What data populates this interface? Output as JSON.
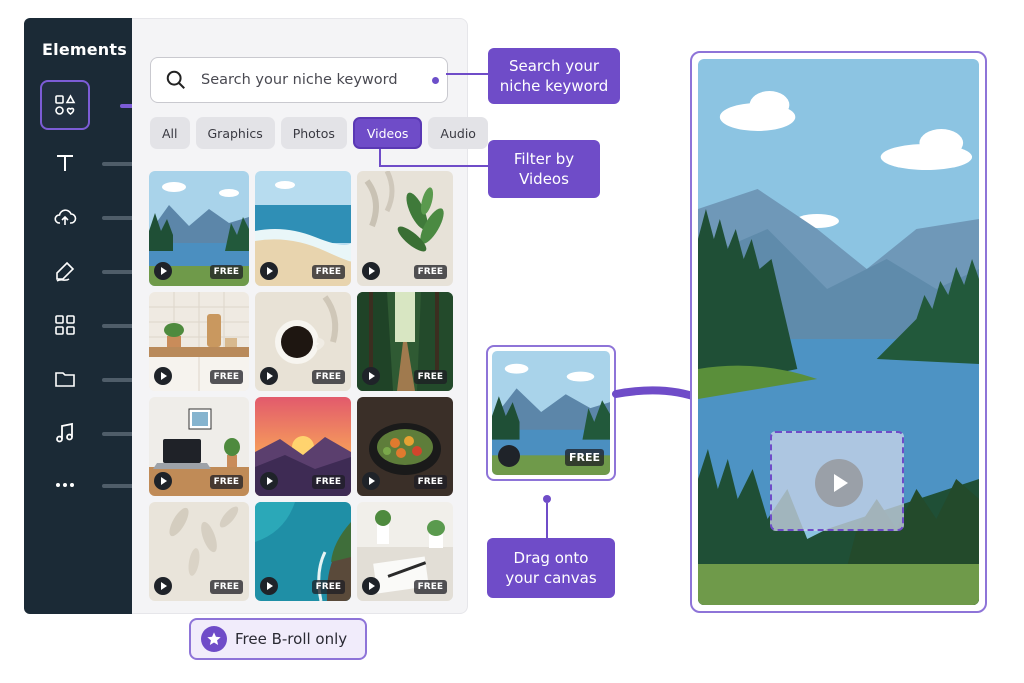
{
  "sidebar": {
    "title": "Elements",
    "items": [
      {
        "name": "elements-icon"
      },
      {
        "name": "text-icon"
      },
      {
        "name": "upload-icon"
      },
      {
        "name": "draw-icon"
      },
      {
        "name": "apps-icon"
      },
      {
        "name": "folder-icon"
      },
      {
        "name": "music-icon"
      },
      {
        "name": "more-icon"
      }
    ]
  },
  "search": {
    "placeholder": "Search your niche keyword"
  },
  "filters": [
    "All",
    "Graphics",
    "Photos",
    "Videos",
    "Audio"
  ],
  "active_filter": "Videos",
  "tiles": [
    {
      "scene": "mountain-lake",
      "badge": "FREE"
    },
    {
      "scene": "beach",
      "badge": "FREE"
    },
    {
      "scene": "plant-shadow",
      "badge": "FREE"
    },
    {
      "scene": "kitchen",
      "badge": "FREE"
    },
    {
      "scene": "coffee",
      "badge": "FREE"
    },
    {
      "scene": "forest-path",
      "badge": "FREE"
    },
    {
      "scene": "laptop-desk",
      "badge": "FREE"
    },
    {
      "scene": "sunset",
      "badge": "FREE"
    },
    {
      "scene": "food-bowl",
      "badge": "FREE"
    },
    {
      "scene": "leaf-shadow",
      "badge": "FREE"
    },
    {
      "scene": "coast",
      "badge": "FREE"
    },
    {
      "scene": "notebook",
      "badge": "FREE"
    }
  ],
  "broll": {
    "label": "Free B-roll only"
  },
  "callouts": {
    "search": "Search your niche keyword",
    "filter": "Filter by Videos",
    "drag": "Drag onto your canvas"
  },
  "clip": {
    "badge": "FREE"
  },
  "colors": {
    "accent": "#6f4cc8",
    "sidebar": "#1b2a36",
    "panel": "#f4f4f6"
  }
}
